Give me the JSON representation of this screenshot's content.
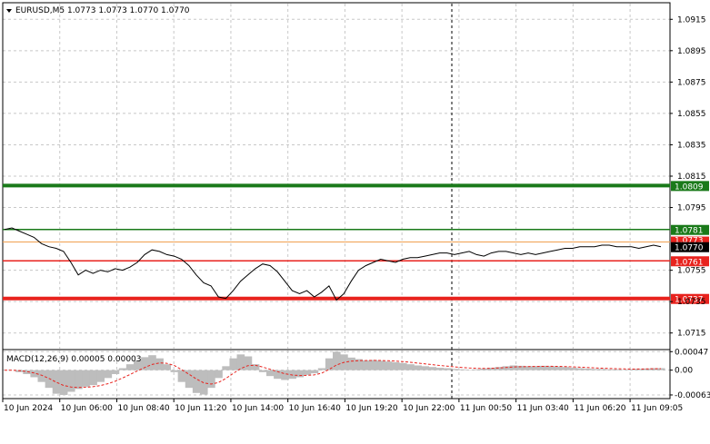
{
  "header": {
    "symbol_line": "EURUSD,M5  1.0773 1.0773 1.0770 1.0770"
  },
  "price_axis": {
    "ticks": [
      "1.0915",
      "1.0895",
      "1.0875",
      "1.0855",
      "1.0835",
      "1.0815",
      "1.0795",
      "1.0755",
      "1.0735",
      "1.0715"
    ]
  },
  "levels": [
    {
      "value": 1.0809,
      "label": "1.0809",
      "color": "#1a7a1a",
      "thick": true
    },
    {
      "value": 1.0781,
      "label": "1.0781",
      "color": "#1a7a1a",
      "thick": false
    },
    {
      "value": 1.0761,
      "label": "1.0761",
      "color": "#e8231e",
      "thick": false
    },
    {
      "value": 1.0737,
      "label": "1.0737",
      "color": "#e8231e",
      "thick": true
    }
  ],
  "current_price": {
    "value": 1.077,
    "label": "1.0770",
    "ask_label": "1.0773"
  },
  "macd": {
    "title": "MACD(12,26,9) 0.00005 0.00003",
    "ticks": [
      "0.00047",
      "0.00",
      "-0.00063"
    ]
  },
  "time_axis": {
    "labels": [
      "10 Jun 2024",
      "10 Jun 06:00",
      "10 Jun 08:40",
      "10 Jun 11:20",
      "10 Jun 14:00",
      "10 Jun 16:40",
      "10 Jun 19:20",
      "10 Jun 22:00",
      "11 Jun 00:50",
      "11 Jun 03:40",
      "11 Jun 06:20",
      "11 Jun 09:05"
    ]
  },
  "chart_data": {
    "type": "line",
    "x_range": [
      "10 Jun 2024",
      "11 Jun 09:05"
    ],
    "price": [
      1.0781,
      1.0782,
      1.078,
      1.0778,
      1.0776,
      1.0772,
      1.077,
      1.0769,
      1.0767,
      1.076,
      1.0752,
      1.0755,
      1.0753,
      1.0755,
      1.0754,
      1.0756,
      1.0755,
      1.0757,
      1.076,
      1.0765,
      1.0768,
      1.0767,
      1.0765,
      1.0764,
      1.0762,
      1.0758,
      1.0752,
      1.0747,
      1.0745,
      1.0738,
      1.0737,
      1.0742,
      1.0748,
      1.0752,
      1.0756,
      1.0759,
      1.0758,
      1.0754,
      1.0748,
      1.0742,
      1.074,
      1.0742,
      1.0738,
      1.0741,
      1.0745,
      1.0736,
      1.074,
      1.0748,
      1.0755,
      1.0758,
      1.076,
      1.0762,
      1.0761,
      1.076,
      1.0762,
      1.0763,
      1.0763,
      1.0764,
      1.0765,
      1.0766,
      1.0766,
      1.0765,
      1.0766,
      1.0767,
      1.0765,
      1.0764,
      1.0766,
      1.0767,
      1.0767,
      1.0766,
      1.0765,
      1.0766,
      1.0765,
      1.0766,
      1.0767,
      1.0768,
      1.0769,
      1.0769,
      1.077,
      1.077,
      1.077,
      1.0771,
      1.0771,
      1.077,
      1.077,
      1.077,
      1.0769,
      1.077,
      1.0771,
      1.077
    ],
    "macd_histogram": [
      0.0,
      0.0,
      -5e-05,
      -0.0001,
      -0.00018,
      -0.0003,
      -0.00045,
      -0.0006,
      -0.00063,
      -0.00055,
      -0.00048,
      -0.00042,
      -0.00038,
      -0.0003,
      -0.0002,
      -0.0001,
      5e-05,
      0.00015,
      0.00025,
      0.00033,
      0.00038,
      0.0003,
      0.00015,
      -5e-05,
      -0.0003,
      -0.00045,
      -0.00058,
      -0.00062,
      -0.00045,
      -0.0002,
      0.0001,
      0.0003,
      0.0004,
      0.00035,
      0.00015,
      -5e-05,
      -0.00015,
      -0.00022,
      -0.00025,
      -0.00022,
      -0.00018,
      -0.00012,
      -8e-05,
      5e-05,
      0.0003,
      0.00047,
      0.0004,
      0.00032,
      0.00028,
      0.00025,
      0.00026,
      0.00024,
      0.00022,
      0.0002,
      0.00018,
      0.00015,
      0.00012,
      0.0001,
      8e-05,
      6e-05,
      5e-05,
      3e-05,
      2e-05,
      1e-05,
      2e-05,
      4e-05,
      6e-05,
      8e-05,
      0.0001,
      0.00012,
      0.00011,
      0.0001,
      0.0001,
      0.00011,
      0.0001,
      9e-05,
      8e-05,
      6e-05,
      5e-05,
      4e-05,
      3e-05,
      3e-05,
      2e-05,
      2e-05,
      1e-05,
      2e-05,
      3e-05,
      4e-05,
      5e-05,
      5e-05
    ],
    "ylim_price": [
      1.0705,
      1.0925
    ],
    "ylim_macd": [
      -0.0007,
      0.0005
    ],
    "grid": true
  },
  "colors": {
    "green": "#1a7a1a",
    "red": "#e8231e",
    "orange_line": "#f0a050",
    "hist": "#bdbdbd",
    "signal": "#e8231e"
  }
}
